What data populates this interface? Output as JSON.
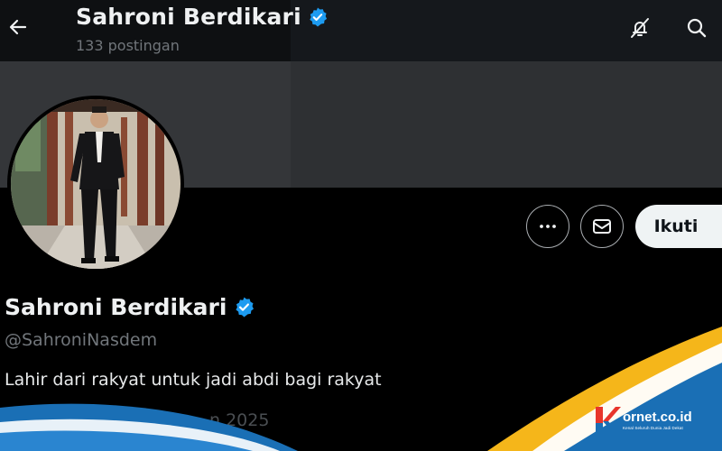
{
  "header": {
    "back_icon": "arrow-left-icon",
    "title": "Sahroni Berdikari",
    "post_count": "133 postingan",
    "icons": [
      "notifications-off-icon",
      "search-icon"
    ]
  },
  "profile": {
    "display_name": "Sahroni Berdikari",
    "handle": "@SahroniNasdem",
    "bio": "Lahir dari rakyat untuk jadi abdi bagi rakyat",
    "joined_partial": "n 2025",
    "verified_color": "#1d9bf0"
  },
  "actions": {
    "more_icon": "more-icon",
    "message_icon": "mail-icon",
    "follow_label": "Ikuti"
  },
  "watermark": {
    "name_prefix": "K",
    "name": "ornet.co.id",
    "tagline": "Kenal Seluruh Dunia Jadi Dekat",
    "colors": {
      "blue": "#1a6fb5",
      "yellow": "#f5b61a",
      "red": "#e8352b"
    }
  }
}
